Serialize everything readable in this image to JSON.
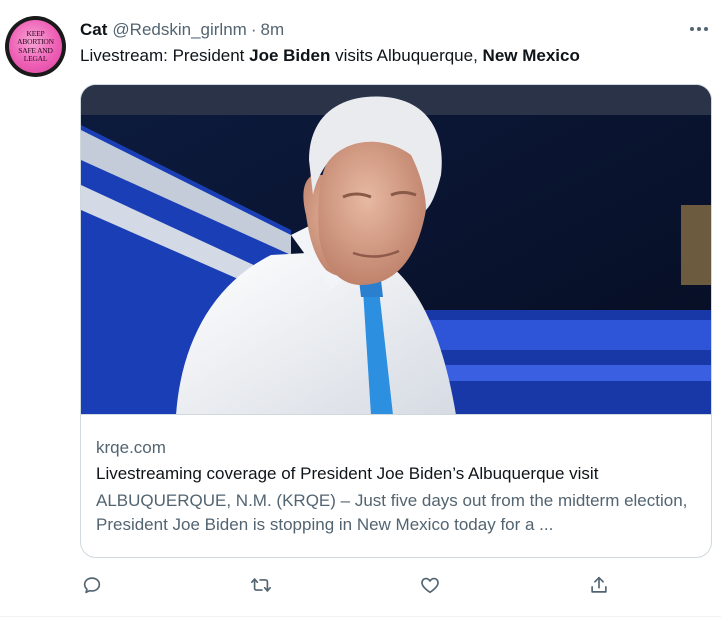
{
  "tweet": {
    "display_name": "Cat",
    "handle": "@Redskin_girlnm",
    "separator": "·",
    "time": "8m",
    "text_parts": [
      "Livestream: President ",
      "Joe Biden",
      " visits Albuquerque, ",
      "New Mexico"
    ],
    "avatar": {
      "lines": [
        "KEEP",
        "ABORTION",
        "SAFE AND",
        "LEGAL"
      ],
      "color": "#ee5fb5"
    },
    "more_icon": "ellipsis-icon"
  },
  "card": {
    "image_alt": "President Joe Biden in white shirt and blue tie",
    "domain": "krqe.com",
    "title": "Livestreaming coverage of President Joe Biden’s Albuquerque visit",
    "description": "ALBUQUERQUE, N.M. (KRQE) – Just five days out from the midterm election, President Joe Biden is stopping in New Mexico today for a ..."
  },
  "actions": [
    {
      "name": "reply-icon"
    },
    {
      "name": "retweet-icon"
    },
    {
      "name": "like-icon"
    },
    {
      "name": "share-icon"
    }
  ],
  "colors": {
    "text": "#0f1419",
    "secondary": "#536471",
    "border": "#cfd9de"
  }
}
